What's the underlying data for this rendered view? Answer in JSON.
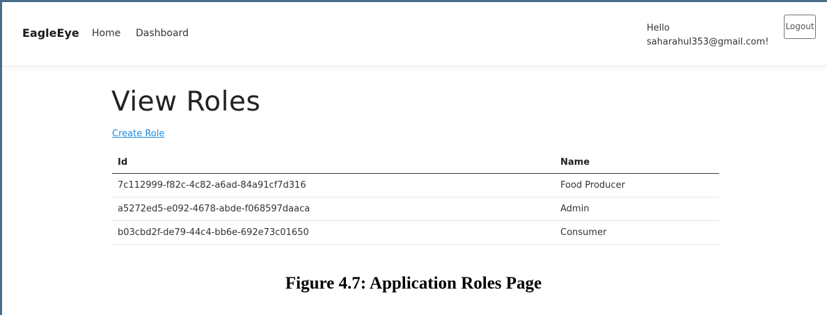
{
  "navbar": {
    "brand": "EagleEye",
    "links": [
      "Home",
      "Dashboard"
    ],
    "greeting_line1": "Hello",
    "greeting_line2": "saharahul353@gmail.com!",
    "logout_label": "Logout"
  },
  "main": {
    "title": "View Roles",
    "create_link": "Create Role",
    "table": {
      "headers": [
        "Id",
        "Name"
      ],
      "rows": [
        [
          "7c112999-f82c-4c82-a6ad-84a91cf7d316",
          "Food Producer"
        ],
        [
          "a5272ed5-e092-4678-abde-f068597daaca",
          "Admin"
        ],
        [
          "b03cbd2f-de79-44c4-bb6e-692e73c01650",
          "Consumer"
        ]
      ]
    }
  },
  "caption": "Figure 4.7: Application Roles Page",
  "colors": {
    "link": "#1b8ee0",
    "frame": "#4a6e8a",
    "text": "#212529"
  }
}
